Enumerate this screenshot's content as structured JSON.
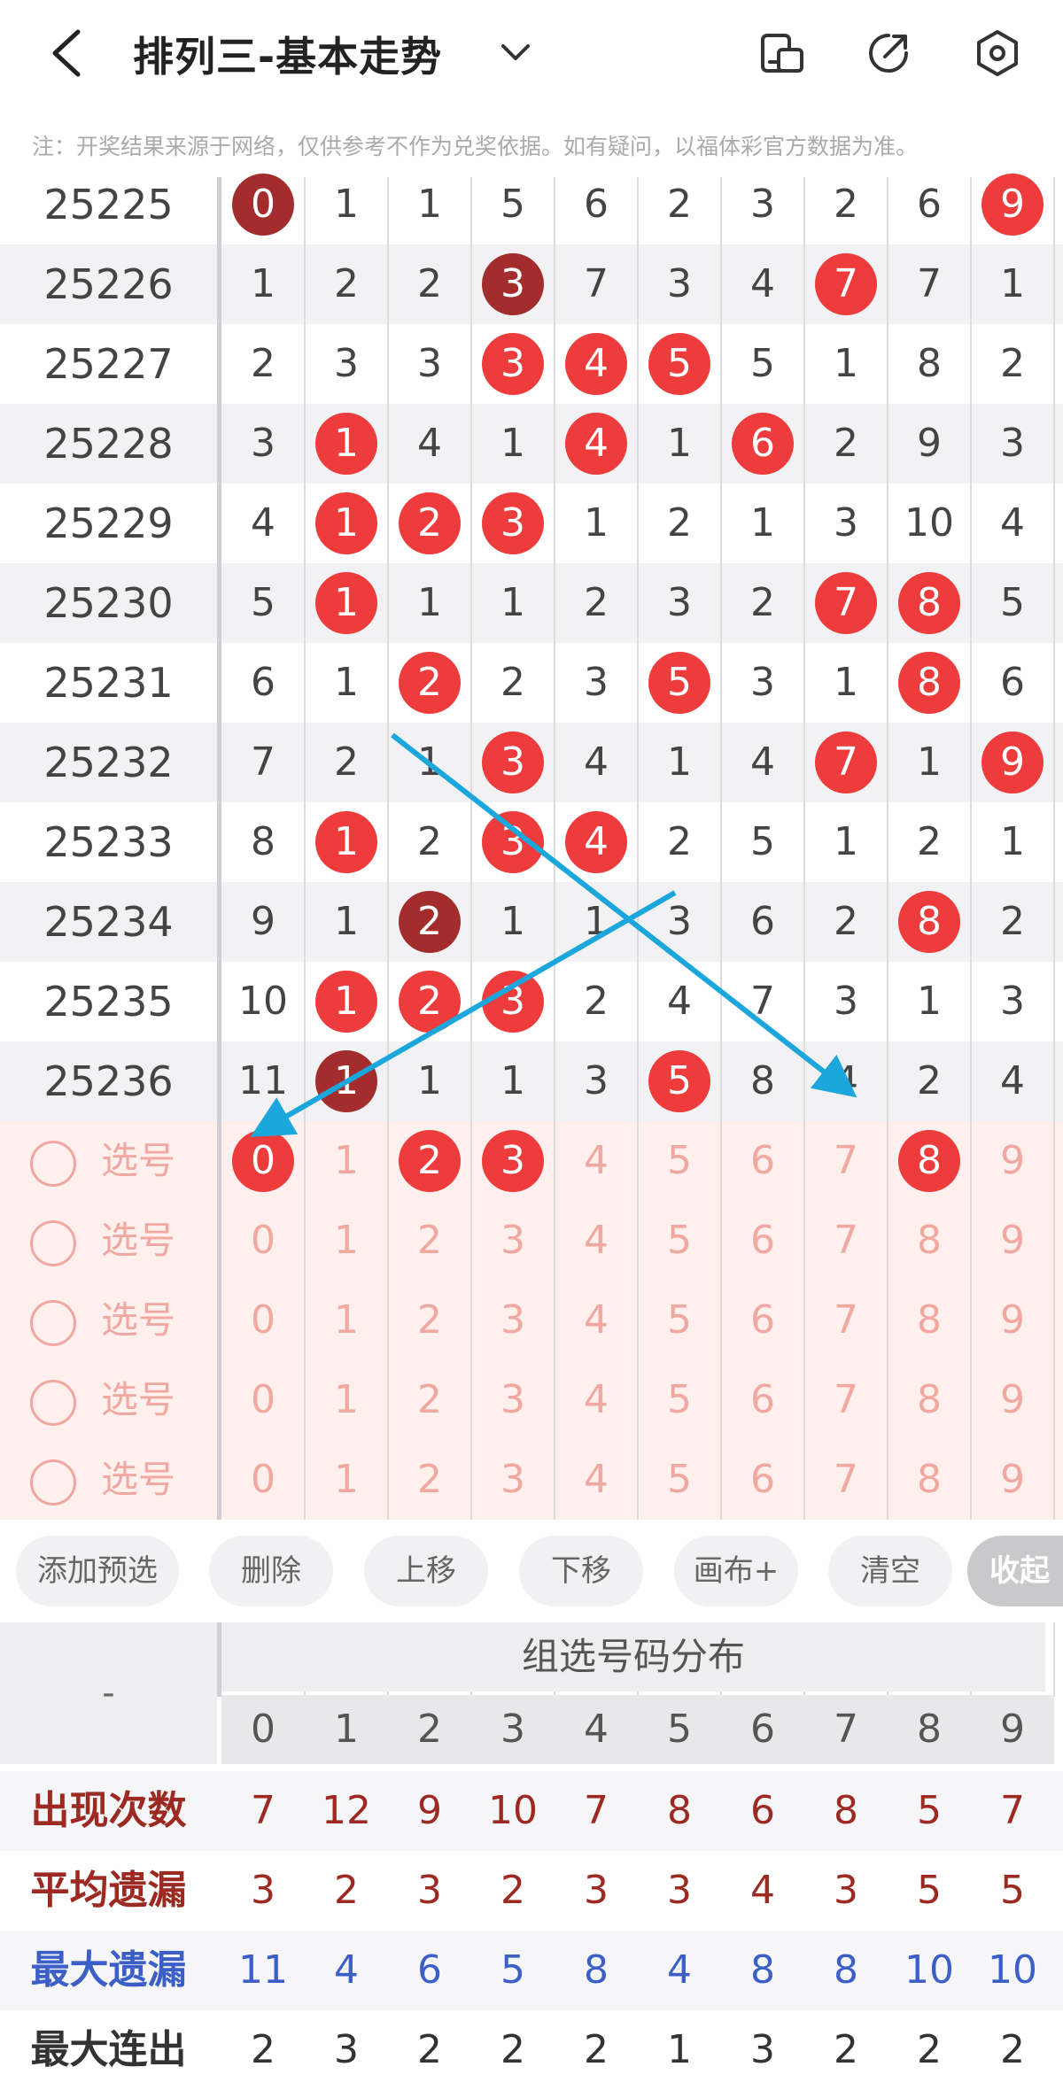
{
  "header": {
    "title": "排列三-基本走势"
  },
  "notice": "注：开奖结果来源于网络，仅供参考不作为兑奖依据。如有疑问，以福体彩官方数据为准。",
  "rows": [
    {
      "issue": "25225",
      "cells": [
        {
          "v": "0",
          "b": "dark"
        },
        {
          "v": "1"
        },
        {
          "v": "1"
        },
        {
          "v": "5"
        },
        {
          "v": "6"
        },
        {
          "v": "2"
        },
        {
          "v": "3"
        },
        {
          "v": "2"
        },
        {
          "v": "6"
        },
        {
          "v": "9",
          "b": "red"
        }
      ]
    },
    {
      "issue": "25226",
      "cells": [
        {
          "v": "1"
        },
        {
          "v": "2"
        },
        {
          "v": "2"
        },
        {
          "v": "3",
          "b": "dark"
        },
        {
          "v": "7"
        },
        {
          "v": "3"
        },
        {
          "v": "4"
        },
        {
          "v": "7",
          "b": "red"
        },
        {
          "v": "7"
        },
        {
          "v": "1"
        }
      ]
    },
    {
      "issue": "25227",
      "cells": [
        {
          "v": "2"
        },
        {
          "v": "3"
        },
        {
          "v": "3"
        },
        {
          "v": "3",
          "b": "red"
        },
        {
          "v": "4",
          "b": "red"
        },
        {
          "v": "5",
          "b": "red"
        },
        {
          "v": "5"
        },
        {
          "v": "1"
        },
        {
          "v": "8"
        },
        {
          "v": "2"
        }
      ]
    },
    {
      "issue": "25228",
      "cells": [
        {
          "v": "3"
        },
        {
          "v": "1",
          "b": "red"
        },
        {
          "v": "4"
        },
        {
          "v": "1"
        },
        {
          "v": "4",
          "b": "red"
        },
        {
          "v": "1"
        },
        {
          "v": "6",
          "b": "red"
        },
        {
          "v": "2"
        },
        {
          "v": "9"
        },
        {
          "v": "3"
        }
      ]
    },
    {
      "issue": "25229",
      "cells": [
        {
          "v": "4"
        },
        {
          "v": "1",
          "b": "red"
        },
        {
          "v": "2",
          "b": "red"
        },
        {
          "v": "3",
          "b": "red"
        },
        {
          "v": "1"
        },
        {
          "v": "2"
        },
        {
          "v": "1"
        },
        {
          "v": "3"
        },
        {
          "v": "10"
        },
        {
          "v": "4"
        }
      ]
    },
    {
      "issue": "25230",
      "cells": [
        {
          "v": "5"
        },
        {
          "v": "1",
          "b": "red"
        },
        {
          "v": "1"
        },
        {
          "v": "1"
        },
        {
          "v": "2"
        },
        {
          "v": "3"
        },
        {
          "v": "2"
        },
        {
          "v": "7",
          "b": "red"
        },
        {
          "v": "8",
          "b": "red"
        },
        {
          "v": "5"
        }
      ]
    },
    {
      "issue": "25231",
      "cells": [
        {
          "v": "6"
        },
        {
          "v": "1"
        },
        {
          "v": "2",
          "b": "red"
        },
        {
          "v": "2"
        },
        {
          "v": "3"
        },
        {
          "v": "5",
          "b": "red"
        },
        {
          "v": "3"
        },
        {
          "v": "1"
        },
        {
          "v": "8",
          "b": "red"
        },
        {
          "v": "6"
        }
      ]
    },
    {
      "issue": "25232",
      "cells": [
        {
          "v": "7"
        },
        {
          "v": "2"
        },
        {
          "v": "1"
        },
        {
          "v": "3",
          "b": "red"
        },
        {
          "v": "4"
        },
        {
          "v": "1"
        },
        {
          "v": "4"
        },
        {
          "v": "7",
          "b": "red"
        },
        {
          "v": "1"
        },
        {
          "v": "9",
          "b": "red"
        }
      ]
    },
    {
      "issue": "25233",
      "cells": [
        {
          "v": "8"
        },
        {
          "v": "1",
          "b": "red"
        },
        {
          "v": "2"
        },
        {
          "v": "3",
          "b": "red"
        },
        {
          "v": "4",
          "b": "red"
        },
        {
          "v": "2"
        },
        {
          "v": "5"
        },
        {
          "v": "1"
        },
        {
          "v": "2"
        },
        {
          "v": "1"
        }
      ]
    },
    {
      "issue": "25234",
      "cells": [
        {
          "v": "9"
        },
        {
          "v": "1"
        },
        {
          "v": "2",
          "b": "dark"
        },
        {
          "v": "1"
        },
        {
          "v": "1"
        },
        {
          "v": "3"
        },
        {
          "v": "6"
        },
        {
          "v": "2"
        },
        {
          "v": "8",
          "b": "red"
        },
        {
          "v": "2"
        }
      ]
    },
    {
      "issue": "25235",
      "cells": [
        {
          "v": "10"
        },
        {
          "v": "1",
          "b": "red"
        },
        {
          "v": "2",
          "b": "red"
        },
        {
          "v": "3",
          "b": "red"
        },
        {
          "v": "2"
        },
        {
          "v": "4"
        },
        {
          "v": "7"
        },
        {
          "v": "3"
        },
        {
          "v": "1"
        },
        {
          "v": "3"
        }
      ]
    },
    {
      "issue": "25236",
      "cells": [
        {
          "v": "11"
        },
        {
          "v": "1",
          "b": "dark"
        },
        {
          "v": "1"
        },
        {
          "v": "1"
        },
        {
          "v": "3"
        },
        {
          "v": "5",
          "b": "red"
        },
        {
          "v": "8"
        },
        {
          "v": "4"
        },
        {
          "v": "2"
        },
        {
          "v": "4"
        }
      ]
    }
  ],
  "pick_rows": [
    {
      "label": "选号",
      "selected": [
        "0",
        "2",
        "3",
        "8"
      ]
    },
    {
      "label": "选号",
      "selected": []
    },
    {
      "label": "选号",
      "selected": []
    },
    {
      "label": "选号",
      "selected": []
    },
    {
      "label": "选号",
      "selected": []
    }
  ],
  "digits": [
    "0",
    "1",
    "2",
    "3",
    "4",
    "5",
    "6",
    "7",
    "8",
    "9"
  ],
  "buttons": {
    "add": "添加预选",
    "delete": "删除",
    "up": "上移",
    "down": "下移",
    "canvas": "画布+",
    "clear": "清空",
    "collapse": "收起"
  },
  "stats": {
    "corner": "-",
    "title": "组选号码分布",
    "rows": [
      {
        "label": "出现次数",
        "color": "#9c2a22",
        "values": [
          "7",
          "12",
          "9",
          "10",
          "7",
          "8",
          "6",
          "8",
          "5",
          "7"
        ]
      },
      {
        "label": "平均遗漏",
        "color": "#9c2a22",
        "values": [
          "3",
          "2",
          "3",
          "2",
          "3",
          "3",
          "4",
          "3",
          "5",
          "5"
        ]
      },
      {
        "label": "最大遗漏",
        "color": "#3b5fc7",
        "values": [
          "11",
          "4",
          "6",
          "5",
          "8",
          "4",
          "8",
          "8",
          "10",
          "10"
        ]
      },
      {
        "label": "最大连出",
        "color": "#333333",
        "values": [
          "2",
          "3",
          "2",
          "2",
          "2",
          "1",
          "3",
          "2",
          "2",
          "2"
        ]
      }
    ]
  },
  "colors": {
    "ball_red": "#ee3b3b",
    "ball_dark": "#a32d2d",
    "arrow": "#1ba6dc",
    "faded": "#f1a8a0"
  }
}
